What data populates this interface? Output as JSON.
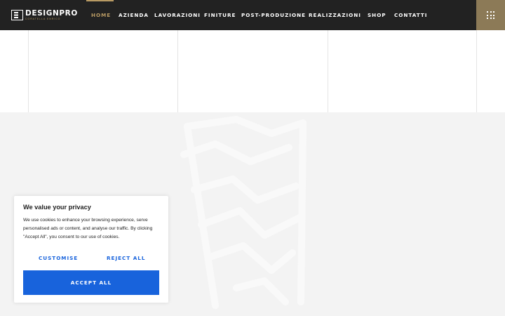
{
  "brand": {
    "name": "DESIGNPRO",
    "subtitle": "CORATELLA ENRICO"
  },
  "nav": {
    "items": [
      {
        "label": "HOME",
        "active": true
      },
      {
        "label": "AZIENDA",
        "active": false
      },
      {
        "label": "LAVORAZIONI",
        "active": false
      },
      {
        "label": "FINITURE",
        "active": false
      },
      {
        "label": "POST-PRODUZIONE",
        "active": false
      },
      {
        "label": "REALIZZAZIONI",
        "active": false
      },
      {
        "label": "SHOP",
        "active": false
      },
      {
        "label": "CONTATTI",
        "active": false
      }
    ],
    "menu_icon": "grid-menu-icon"
  },
  "cookie_banner": {
    "title": "We value your privacy",
    "body": "We use cookies to enhance your browsing experience, serve personalised ads or content, and analyse our traffic. By clicking \"Accept All\", you consent to our use of cookies.",
    "customise_label": "CUSTOMISE",
    "reject_label": "REJECT ALL",
    "accept_label": "ACCEPT ALL"
  },
  "colors": {
    "header_bg": "#222222",
    "accent_gold": "#b89a63",
    "menu_button_bg": "#8c7a57",
    "cookie_button_blue": "#1863dc",
    "section_grey": "#f3f3f3"
  }
}
